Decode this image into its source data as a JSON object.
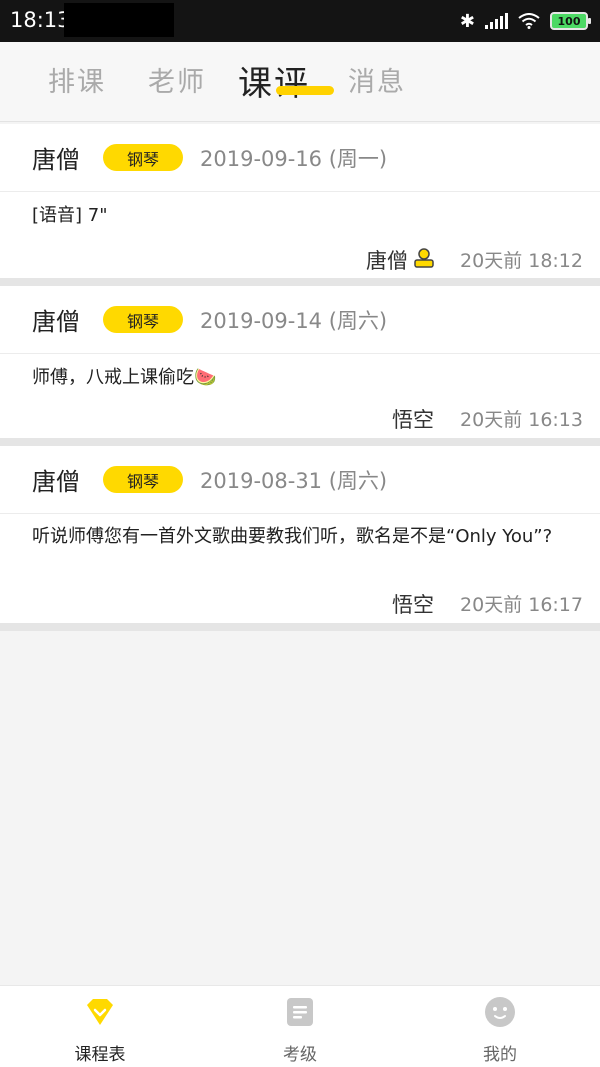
{
  "status_bar": {
    "time": "18:13",
    "battery": "100"
  },
  "tabs": [
    {
      "label": "排课",
      "active": false
    },
    {
      "label": "老师",
      "active": false
    },
    {
      "label": "课评",
      "active": true
    },
    {
      "label": "消息",
      "active": false
    }
  ],
  "reviews": [
    {
      "teacher": "唐僧",
      "subject": "钢琴",
      "date": "2019-09-16 (周一)",
      "comment": "[语音] 7\"",
      "author": "唐僧",
      "time": "20天前 18:12"
    },
    {
      "teacher": "唐僧",
      "subject": "钢琴",
      "date": "2019-09-14 (周六)",
      "comment": "师傅，八戒上课偷吃🍉",
      "author": "悟空",
      "time": "20天前 16:13"
    },
    {
      "teacher": "唐僧",
      "subject": "钢琴",
      "date": "2019-08-31 (周六)",
      "comment": "听说师傅您有一首外文歌曲要教我们听，歌名是不是“Only You”?",
      "author": "悟空",
      "time": "20天前 16:17"
    }
  ],
  "bottom_nav": [
    {
      "label": "课程表",
      "icon": "schedule-icon",
      "active": true
    },
    {
      "label": "考级",
      "icon": "document-icon",
      "active": false
    },
    {
      "label": "我的",
      "icon": "face-icon",
      "active": false
    }
  ],
  "colors": {
    "accent": "#ffd900",
    "inactive_icon": "#c8c8c8"
  }
}
